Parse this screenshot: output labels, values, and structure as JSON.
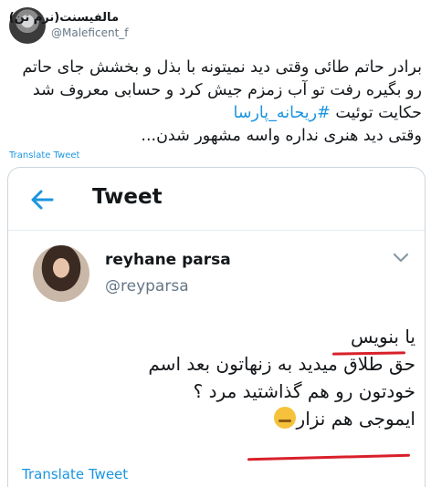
{
  "author": {
    "name": "مالفیسنت(نرم تن)",
    "handle": "@Maleficent_f"
  },
  "tweet": {
    "line1": "برادر حاتم طائی وقتی دید نمیتونه با بذل و بخشش جای حاتم",
    "line2": "رو بگیره رفت تو آب زمزم جیش کرد و حسابی معروف شد",
    "line3_prefix": "حکایت توئیت ",
    "hashtag": "#ریحانه_پارسا",
    "line4": "وقتی دید هنری نداره واسه مشهور شدن...",
    "translate_label": "Translate Tweet"
  },
  "embedded": {
    "title": "Tweet",
    "name": "reyhane parsa",
    "handle": "@reyparsa",
    "line1": "یا بنویس",
    "line2": "حق طلاق میدید به زنهاتون بعد اسم",
    "line3": "خودتون رو هم گذاشتید مرد ؟",
    "line4": "ایموجی هم نزار",
    "translate_label": "Translate Tweet"
  },
  "icons": {
    "back": "arrow-left-icon",
    "more": "chevron-down-icon",
    "emoji": "tired-face-emoji"
  },
  "colors": {
    "link": "#1b95e0",
    "underline": "#d8202a"
  }
}
